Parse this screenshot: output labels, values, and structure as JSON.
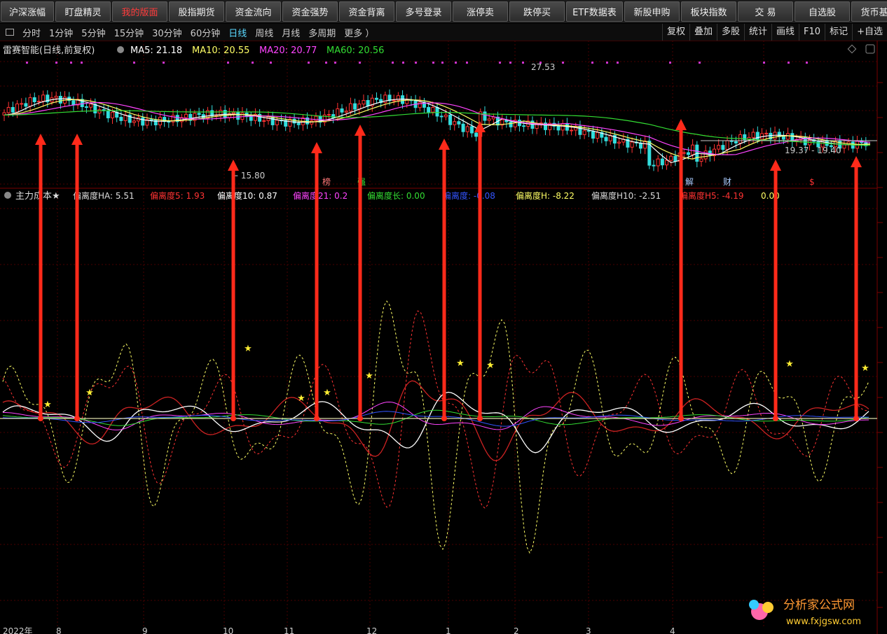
{
  "top_buttons": [
    {
      "label": "沪深涨幅",
      "active": false
    },
    {
      "label": "盯盘精灵",
      "active": false
    },
    {
      "label": "我的版面",
      "active": true
    },
    {
      "label": "股指期货",
      "active": false
    },
    {
      "label": "资金流向",
      "active": false
    },
    {
      "label": "资金强势",
      "active": false
    },
    {
      "label": "资金背离",
      "active": false
    },
    {
      "label": "多号登录",
      "active": false
    },
    {
      "label": "涨停卖",
      "active": false
    },
    {
      "label": "跌停买",
      "active": false
    },
    {
      "label": "ETF数据表",
      "active": false
    },
    {
      "label": "新股申购",
      "active": false
    },
    {
      "label": "板块指数",
      "active": false
    },
    {
      "label": "交 易",
      "active": false
    },
    {
      "label": "自选股",
      "active": false
    },
    {
      "label": "货币基金",
      "active": false
    }
  ],
  "periods": [
    {
      "label": "分时",
      "active": false
    },
    {
      "label": "1分钟",
      "active": false
    },
    {
      "label": "5分钟",
      "active": false
    },
    {
      "label": "15分钟",
      "active": false
    },
    {
      "label": "30分钟",
      "active": false
    },
    {
      "label": "60分钟",
      "active": false
    },
    {
      "label": "日线",
      "active": true
    },
    {
      "label": "周线",
      "active": false
    },
    {
      "label": "月线",
      "active": false
    },
    {
      "label": "多周期",
      "active": false
    },
    {
      "label": "更多 ）",
      "active": false
    }
  ],
  "tools": [
    "复权",
    "叠加",
    "多股",
    "统计",
    "画线",
    "F10",
    "标记",
    "+自选"
  ],
  "upper": {
    "title": "雷赛智能(日线,前复权)",
    "ma": [
      {
        "text": "MA5: 21.18",
        "color": "#ffffff"
      },
      {
        "text": "MA10: 20.55",
        "color": "#ffff66"
      },
      {
        "text": "MA20: 20.77",
        "color": "#ff44ff"
      },
      {
        "text": "MA60: 20.56",
        "color": "#33dd33"
      }
    ],
    "high_label": "27.53",
    "low_label": "15.80",
    "range_label": "19.37 - 19.40",
    "markers": [
      {
        "text": "榜",
        "color": "#ff7777"
      },
      {
        "text": "强",
        "color": "#33dd33"
      },
      {
        "text": "解",
        "color": "#aaccff"
      },
      {
        "text": "财",
        "color": "#aaccff"
      },
      {
        "text": "$",
        "color": "#ff3333"
      }
    ]
  },
  "lower": {
    "title": "主力成本★",
    "legend": [
      {
        "text": "偏离度HA: 5.51",
        "color": "#dddddd"
      },
      {
        "text": "偏离度5: 1.93",
        "color": "#ff3333"
      },
      {
        "text": "偏离度10: 0.87",
        "color": "#ffffff"
      },
      {
        "text": "偏离度21: 0.2",
        "color": "#ff44ff"
      },
      {
        "text": "偏离度长: 0.00",
        "color": "#33dd33"
      },
      {
        "text": "偏离度: -0.08",
        "color": "#3355ff"
      },
      {
        "text": "偏离度H: -8.22",
        "color": "#ffff66"
      },
      {
        "text": "偏离度H10: -2.51",
        "color": "#dddddd"
      },
      {
        "text": "偏离度H5: -4.19",
        "color": "#ff3333"
      },
      {
        "text": "0.00",
        "color": "#ffff66"
      }
    ]
  },
  "x_axis": {
    "labels": [
      "2022年",
      "8",
      "9",
      "10",
      "11",
      "12",
      "1",
      "2",
      "3",
      "4"
    ]
  },
  "watermark": {
    "cn": "分析家公式网",
    "url": "www.fxjgsw.com"
  },
  "colors": {
    "up": "#ff3333",
    "down": "#33dddd",
    "grid": "#5a0000",
    "arrow": "#ff2a1a"
  }
}
